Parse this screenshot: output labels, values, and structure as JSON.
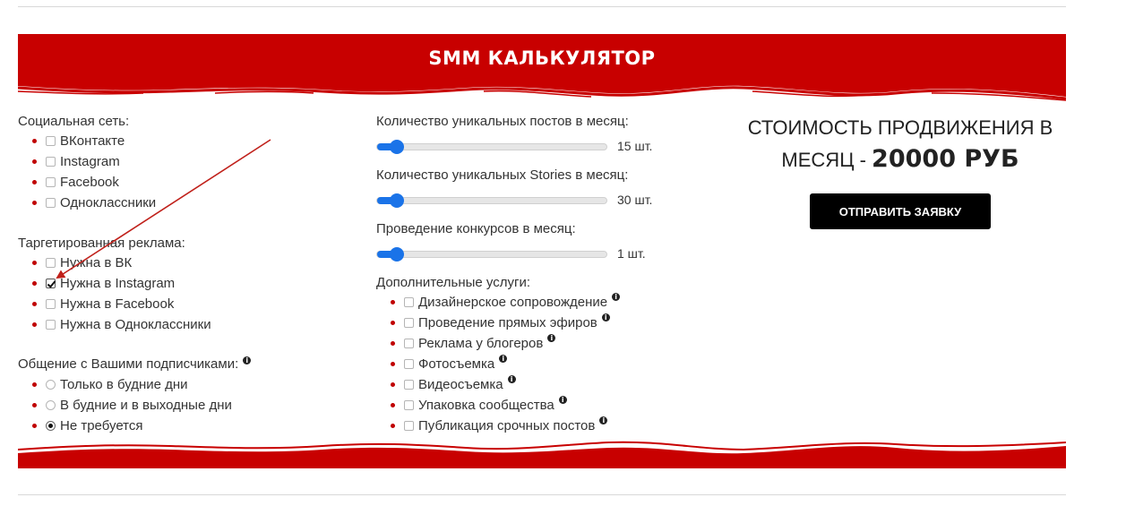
{
  "header": {
    "title": "SMM КАЛЬКУЛЯТОР"
  },
  "colors": {
    "banner": "#c80000",
    "slider": "#1a73e8",
    "bullet": "#c00000",
    "arrow": "#c0201a",
    "button": "#000000"
  },
  "social": {
    "label": "Социальная сеть:",
    "items": [
      {
        "label": "ВКонтакте",
        "checked": false
      },
      {
        "label": "Instagram",
        "checked": false
      },
      {
        "label": "Facebook",
        "checked": false
      },
      {
        "label": "Одноклассники",
        "checked": false
      }
    ]
  },
  "targeting": {
    "label": "Таргетированная реклама:",
    "items": [
      {
        "label": "Нужна в ВК",
        "checked": false
      },
      {
        "label": "Нужна в Instagram",
        "checked": true
      },
      {
        "label": "Нужна в Facebook",
        "checked": false
      },
      {
        "label": "Нужна в Одноклассники",
        "checked": false
      }
    ]
  },
  "communication": {
    "label": "Общение с Вашими подписчиками:",
    "info_icon": "info-icon",
    "items": [
      {
        "label": "Только в будние дни",
        "selected": false
      },
      {
        "label": "В будние и в выходные дни",
        "selected": false
      },
      {
        "label": "Не требуется",
        "selected": true
      }
    ]
  },
  "sliders": [
    {
      "label": "Количество уникальных постов в месяц:",
      "value_text": "15 шт.",
      "fraction": 0.06
    },
    {
      "label": "Количество уникальных Stories в месяц:",
      "value_text": "30 шт.",
      "fraction": 0.06
    },
    {
      "label": "Проведение конкурсов в месяц:",
      "value_text": "1 шт.",
      "fraction": 0.06
    }
  ],
  "extras": {
    "label": "Дополнительные услуги:",
    "items": [
      {
        "label": "Дизайнерское сопровождение",
        "checked": false
      },
      {
        "label": "Проведение прямых эфиров",
        "checked": false
      },
      {
        "label": "Реклама у блогеров",
        "checked": false
      },
      {
        "label": "Фотосъемка",
        "checked": false
      },
      {
        "label": "Видеосъемка",
        "checked": false
      },
      {
        "label": "Упаковка сообщества",
        "checked": false
      },
      {
        "label": "Публикация срочных постов",
        "checked": false
      }
    ]
  },
  "price": {
    "line1": "СТОИМОСТЬ ПРОДВИЖЕНИЯ В",
    "line2_prefix": "МЕСЯЦ -",
    "amount": "20000 РУБ"
  },
  "submit_label": "ОТПРАВИТЬ ЗАЯВКУ"
}
